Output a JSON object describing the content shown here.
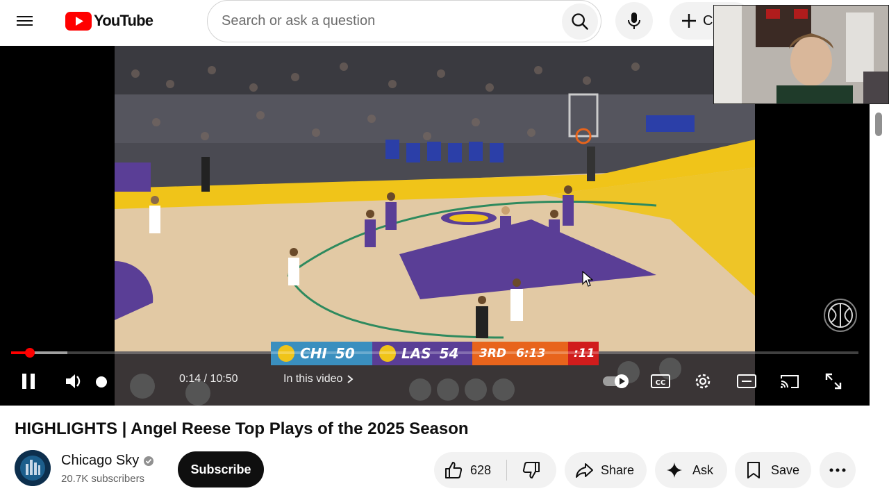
{
  "header": {
    "logo_text": "YouTube",
    "search_placeholder": "Search or ask a question",
    "create_label": "Create"
  },
  "player": {
    "current_time": "0:14",
    "duration": "10:50",
    "time_display": "0:14 / 10:50",
    "progress_fraction": 0.022,
    "buffer_fraction": 0.066,
    "volume_fraction": 1.0,
    "chapter_label": "In this video",
    "scorebug": {
      "team1": "CHI",
      "score1": "50",
      "team2": "LAS",
      "score2": "54",
      "period": "3RD",
      "clock": "6:13",
      "shot_clock": ":11"
    }
  },
  "video": {
    "title": "HIGHLIGHTS | Angel Reese Top Plays of the 2025 Season",
    "channel_name": "Chicago Sky",
    "subscriber_count": "20.7K subscribers",
    "subscribe_label": "Subscribe",
    "like_count": "628",
    "share_label": "Share",
    "ask_label": "Ask",
    "save_label": "Save"
  },
  "colors": {
    "accent_red": "#ff0000",
    "button_bg": "#f2f2f2",
    "subscribe_bg": "#0f0f0f"
  }
}
